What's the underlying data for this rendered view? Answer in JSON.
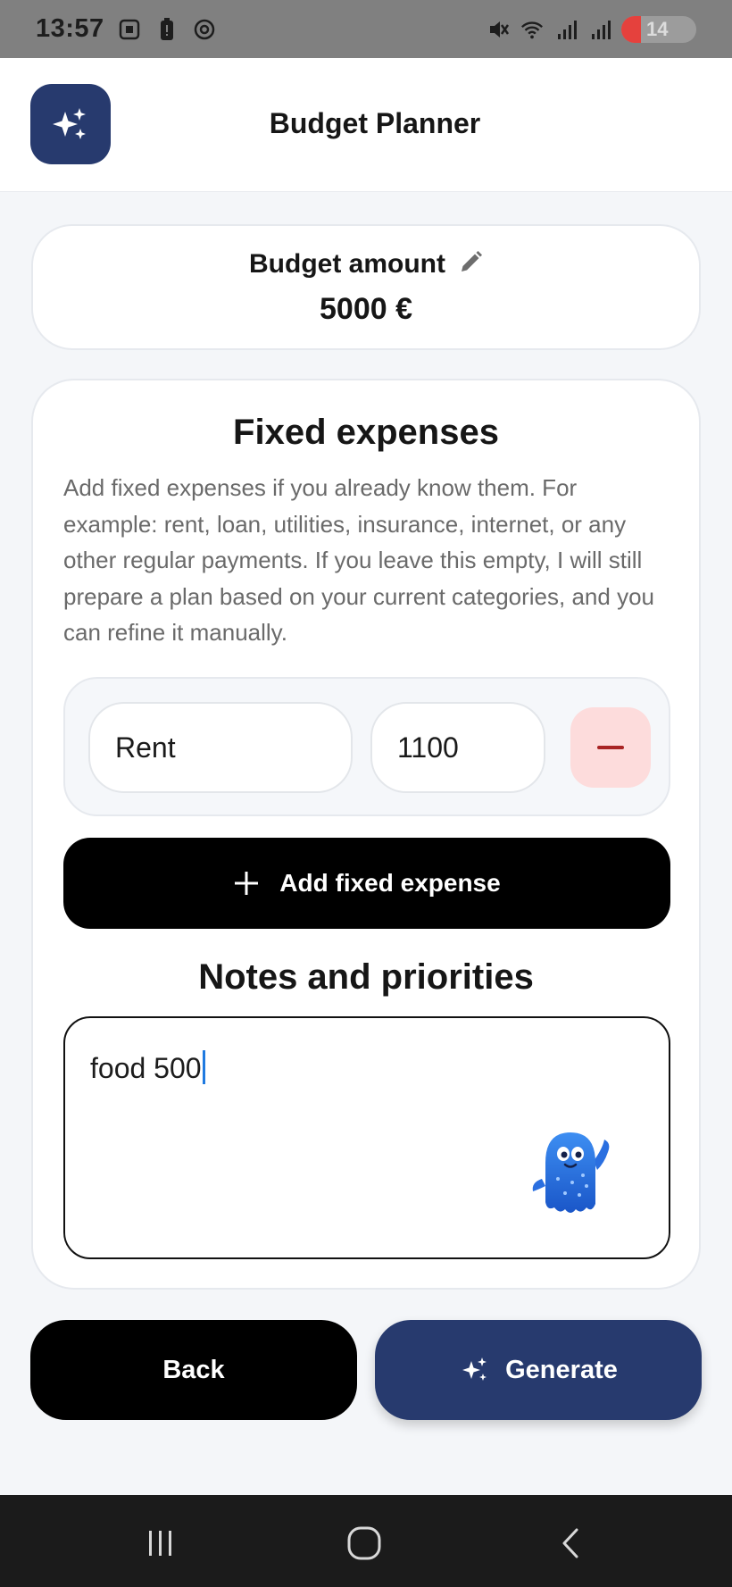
{
  "status_bar": {
    "time": "13:57",
    "battery": "14"
  },
  "header": {
    "title": "Budget Planner",
    "logo_icon": "sparkles-icon",
    "accent_color": "#273a6e"
  },
  "budget": {
    "label": "Budget amount",
    "value": "5000 €",
    "edit_icon": "pencil-icon"
  },
  "fixed_expenses": {
    "title": "Fixed expenses",
    "description": "Add fixed expenses if you already know them. For example: rent, loan, utilities, insurance, internet, or any other regular payments. If you leave this empty, I will still prepare a plan based on your current categories, and you can refine it manually.",
    "items": [
      {
        "name": "Rent",
        "amount": "1100"
      }
    ],
    "add_label": "Add fixed expense"
  },
  "notes": {
    "title": "Notes and priorities",
    "value": "food 500"
  },
  "actions": {
    "back_label": "Back",
    "generate_label": "Generate"
  },
  "colors": {
    "primary": "#273a6e",
    "danger_bg": "#fddcdc",
    "danger": "#a82424",
    "background": "#f4f6f9"
  }
}
